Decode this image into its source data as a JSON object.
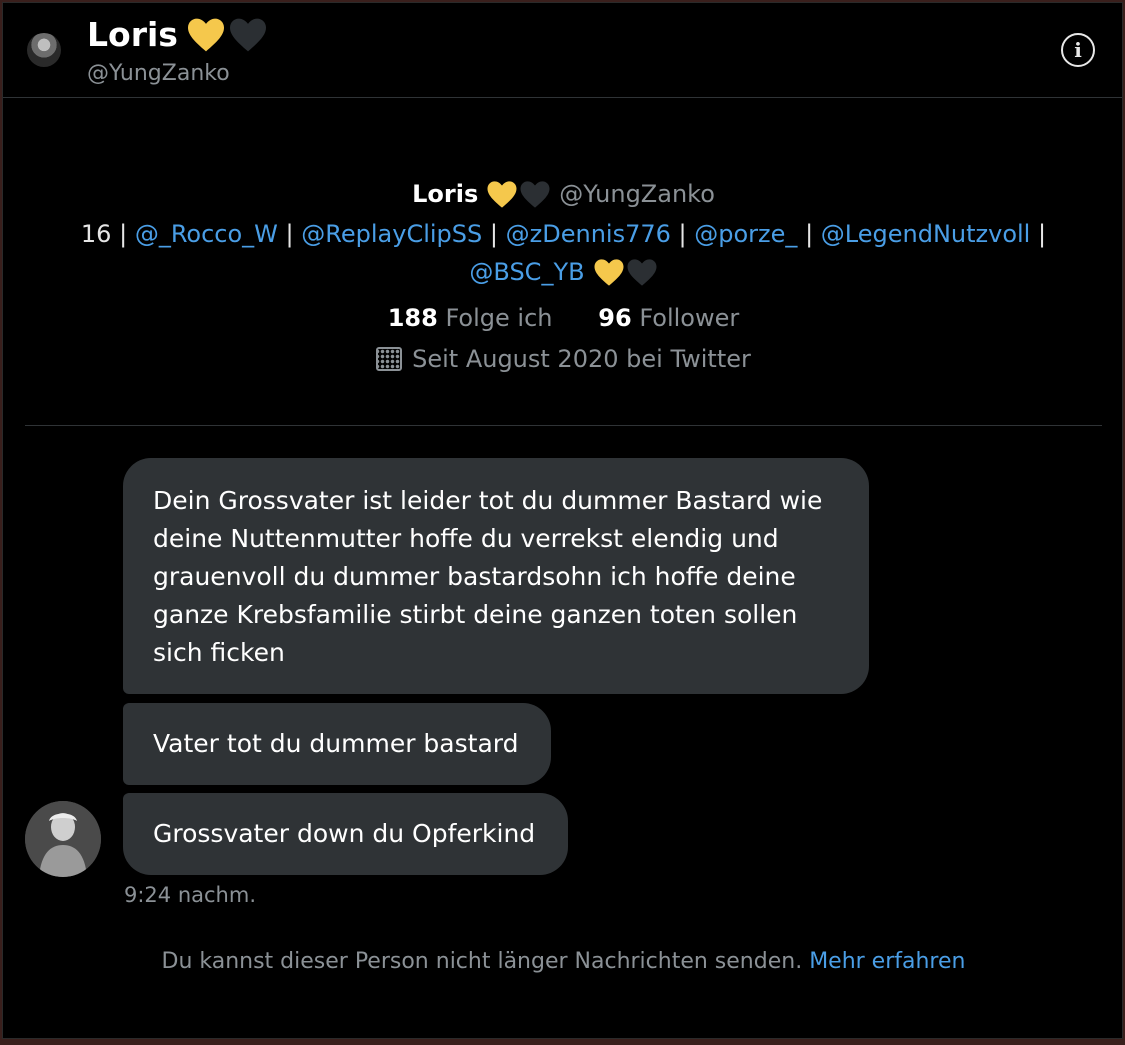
{
  "header": {
    "name": "Loris",
    "handle": "@YungZanko",
    "info_icon": "info-icon"
  },
  "profile": {
    "name": "Loris",
    "handle": "@YungZanko",
    "bio_prefix": "16 |",
    "bio_links": [
      "@_Rocco_W",
      "@ReplayClipSS",
      "@zDennis776",
      "@porze_",
      "@LegendNutzvoll",
      "@BSC_YB"
    ],
    "following_count": "188",
    "following_label": "Folge ich",
    "followers_count": "96",
    "followers_label": "Follower",
    "joined": "Seit August 2020 bei Twitter"
  },
  "messages": [
    "Dein Grossvater ist leider tot du dummer Bastard wie deine Nuttenmutter hoffe du verrekst elendig und grauenvoll du dummer bastardsohn ich hoffe deine ganze Krebsfamilie stirbt deine ganzen toten sollen sich ficken",
    "Vater tot du dummer bastard",
    "Grossvater down du Opferkind"
  ],
  "timestamp": "9:24 nachm.",
  "notice": {
    "text": "Du kannst dieser Person nicht länger Nachrichten senden.",
    "link": "Mehr erfahren"
  },
  "colors": {
    "background": "#000000",
    "bubble": "#2f3336",
    "link": "#4a9ee6",
    "muted": "#8b9196",
    "heart_yellow": "#f5c84c",
    "heart_black": "#2b2f33"
  }
}
